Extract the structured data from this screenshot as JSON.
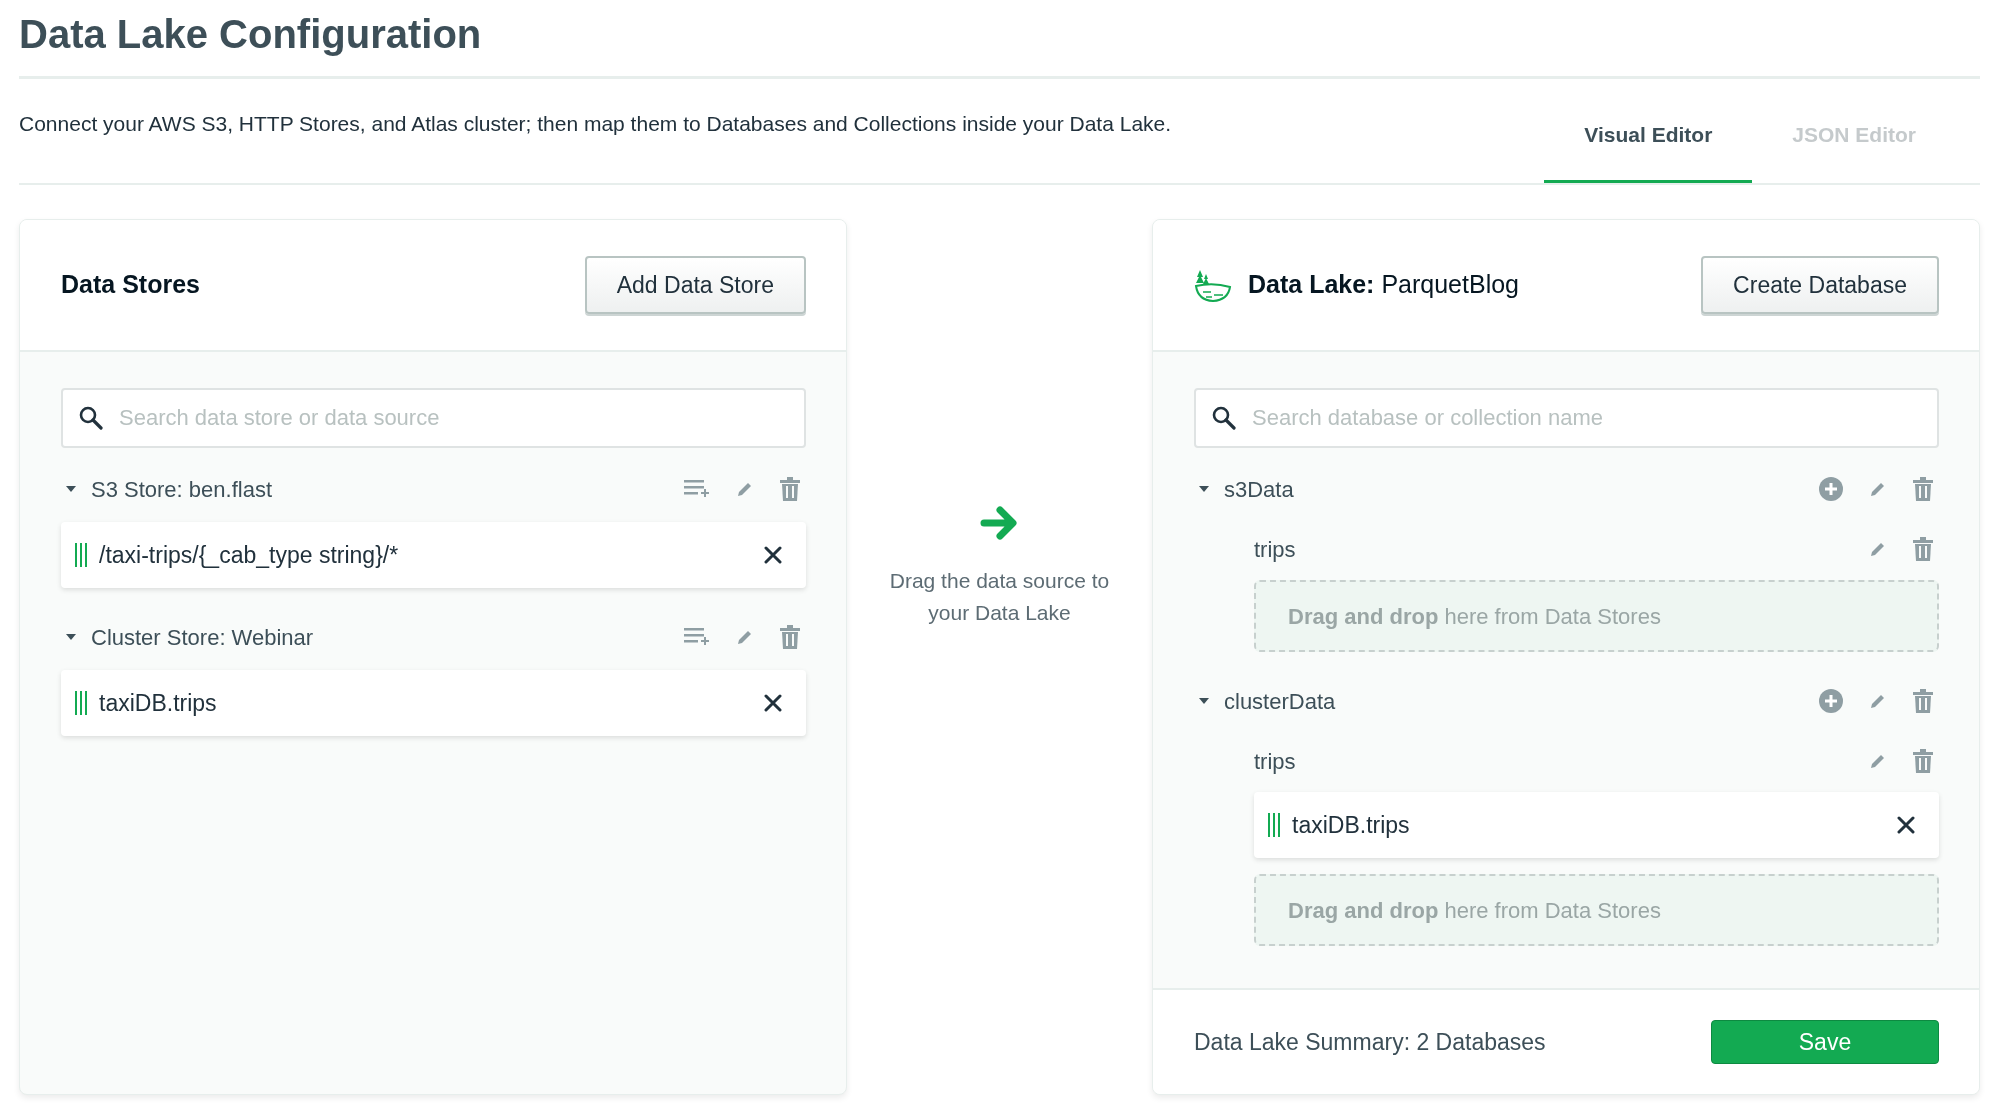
{
  "title": "Data Lake Configuration",
  "description": "Connect your AWS S3, HTTP Stores, and Atlas cluster; then map them to Databases and Collections inside your Data Lake.",
  "tabs": [
    {
      "label": "Visual Editor",
      "selected": true
    },
    {
      "label": "JSON Editor",
      "selected": false
    }
  ],
  "data_stores": {
    "title": "Data Stores",
    "add_button": "Add Data Store",
    "search": {
      "placeholder": "Search data store or data source"
    },
    "stores": [
      {
        "name": "S3 Store: ben.flast",
        "expanded": true,
        "sources": [
          "/taxi-trips/{_cab_type string}/*"
        ]
      },
      {
        "name": "Cluster Store: Webinar",
        "expanded": true,
        "sources": [
          "taxiDB.trips"
        ]
      }
    ]
  },
  "hint": "Drag the data source to your Data Lake",
  "data_lake": {
    "label": "Data Lake:",
    "name": "ParquetBlog",
    "create_button": "Create Database",
    "search": {
      "placeholder": "Search database or collection name"
    },
    "databases": [
      {
        "name": "s3Data",
        "expanded": true,
        "collections": [
          {
            "name": "trips",
            "drop_hint": "**Drag and drop** here from Data Stores"
          }
        ]
      },
      {
        "name": "clusterData",
        "expanded": true,
        "collections": [
          {
            "name": "trips",
            "sources": [
              "taxiDB.trips"
            ],
            "drop_hint": "**Drag and drop** here from Data Stores"
          }
        ]
      }
    ],
    "summary": "Data Lake Summary: 2 Databases",
    "save_button": "Save"
  }
}
